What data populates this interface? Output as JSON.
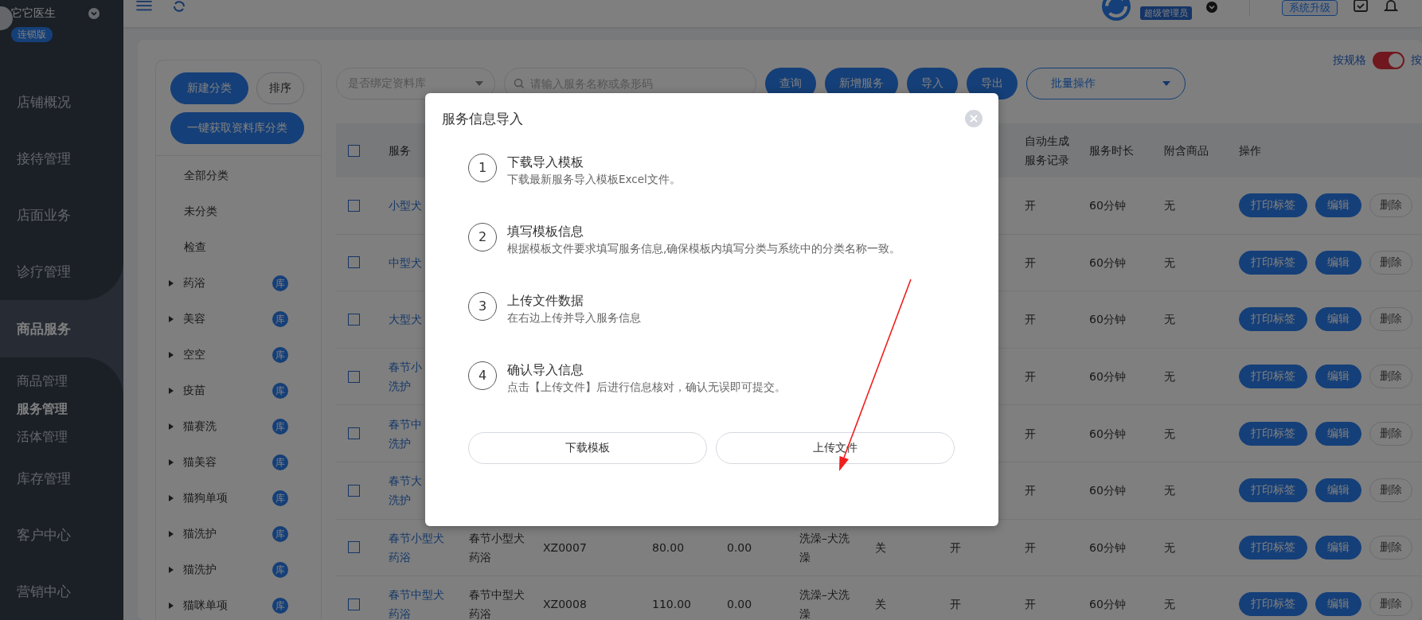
{
  "app": {
    "name": "它它医生",
    "edition": "连锁版"
  },
  "topbar": {
    "role_badge": "超级管理员",
    "upgrade_button": "系统升级"
  },
  "sidebar": {
    "items": [
      {
        "label": "店铺概况",
        "selected": false
      },
      {
        "label": "接待管理",
        "selected": false
      },
      {
        "label": "店面业务",
        "selected": false
      },
      {
        "label": "诊疗管理",
        "selected": false
      },
      {
        "label": "商品服务",
        "selected": true,
        "children": [
          {
            "label": "商品管理",
            "selected": false
          },
          {
            "label": "服务管理",
            "selected": true
          },
          {
            "label": "活体管理",
            "selected": false
          }
        ]
      },
      {
        "label": "库存管理",
        "selected": false
      },
      {
        "label": "客户中心",
        "selected": false
      },
      {
        "label": "营销中心",
        "selected": false
      }
    ]
  },
  "categories": {
    "buttons": [
      {
        "label": "新建分类",
        "kind": "primary"
      },
      {
        "label": "排序",
        "kind": "outline"
      },
      {
        "label": "一键获取资料库分类",
        "kind": "primary"
      }
    ],
    "items": [
      {
        "label": "全部分类",
        "expandable": false
      },
      {
        "label": "未分类",
        "expandable": false
      },
      {
        "label": "检查",
        "expandable": false
      },
      {
        "label": "药浴",
        "expandable": true,
        "badge": "库"
      },
      {
        "label": "美容",
        "expandable": true,
        "badge": "库"
      },
      {
        "label": "空空",
        "expandable": true,
        "badge": "库"
      },
      {
        "label": "疫苗",
        "expandable": true,
        "badge": "库"
      },
      {
        "label": "猫赛洗",
        "expandable": true,
        "badge": "库"
      },
      {
        "label": "猫美容",
        "expandable": true,
        "badge": "库"
      },
      {
        "label": "猫狗单项",
        "expandable": true,
        "badge": "库"
      },
      {
        "label": "猫洗护",
        "expandable": true,
        "badge": "库"
      },
      {
        "label": "猫洗护",
        "expandable": true,
        "badge": "库"
      },
      {
        "label": "猫咪单项",
        "expandable": true,
        "badge": "库"
      }
    ]
  },
  "toolbar": {
    "bind_filter": {
      "placeholder": "是否绑定资料库"
    },
    "search": {
      "placeholder": "请输入服务名称或条形码"
    },
    "buttons": [
      "查询",
      "新增服务",
      "导入",
      "导出"
    ],
    "batch": {
      "label": "批量操作"
    },
    "spec_toggle": {
      "label": "按规格",
      "on": true,
      "after": "按"
    }
  },
  "table": {
    "header": {
      "checked": false,
      "service": "服务",
      "auto_record": "自动生成服务记录",
      "duration": "服务时长",
      "goods": "附含商品",
      "actions": "操作"
    },
    "rows": [
      {
        "checked": false,
        "name_lines": [
          "小型犬"
        ],
        "auto_record": "开",
        "duration": "60分钟",
        "goods": "无",
        "actions": [
          {
            "label": "打印标签",
            "kind": "primary"
          },
          {
            "label": "编辑",
            "kind": "primary"
          },
          {
            "label": "删除",
            "kind": "outline"
          }
        ]
      },
      {
        "checked": false,
        "name_lines": [
          "中型犬"
        ],
        "auto_record": "开",
        "duration": "60分钟",
        "goods": "无",
        "actions": [
          {
            "label": "打印标签",
            "kind": "primary"
          },
          {
            "label": "编辑",
            "kind": "primary"
          },
          {
            "label": "删除",
            "kind": "outline"
          }
        ]
      },
      {
        "checked": false,
        "name_lines": [
          "大型犬"
        ],
        "auto_record": "开",
        "duration": "60分钟",
        "goods": "无",
        "actions": [
          {
            "label": "打印标签",
            "kind": "primary"
          },
          {
            "label": "编辑",
            "kind": "primary"
          },
          {
            "label": "删除",
            "kind": "outline"
          }
        ]
      },
      {
        "checked": false,
        "name_lines": [
          "春节小",
          "洗护"
        ],
        "auto_record": "开",
        "duration": "60分钟",
        "goods": "无",
        "actions": [
          {
            "label": "打印标签",
            "kind": "primary"
          },
          {
            "label": "编辑",
            "kind": "primary"
          },
          {
            "label": "删除",
            "kind": "outline"
          }
        ]
      },
      {
        "checked": false,
        "name_lines": [
          "春节中",
          "洗护"
        ],
        "auto_record": "开",
        "duration": "60分钟",
        "goods": "无",
        "actions": [
          {
            "label": "打印标签",
            "kind": "primary"
          },
          {
            "label": "编辑",
            "kind": "primary"
          },
          {
            "label": "删除",
            "kind": "outline"
          }
        ]
      },
      {
        "checked": false,
        "name_lines": [
          "春节大",
          "洗护"
        ],
        "auto_record": "开",
        "duration": "60分钟",
        "goods": "无",
        "actions": [
          {
            "label": "打印标签",
            "kind": "primary"
          },
          {
            "label": "编辑",
            "kind": "primary"
          },
          {
            "label": "删除",
            "kind": "outline"
          }
        ]
      },
      {
        "checked": false,
        "name_lines": [
          "春节小型犬",
          "药浴"
        ],
        "alias": "春节小型犬药浴",
        "code": "XZ0007",
        "price": "80.00",
        "cost": "0.00",
        "category": "洗澡–犬洗澡",
        "column_7": "关",
        "column_8": "开",
        "auto_record": "开",
        "duration": "60分钟",
        "goods": "无",
        "actions": [
          {
            "label": "打印标签",
            "kind": "primary"
          },
          {
            "label": "编辑",
            "kind": "primary"
          },
          {
            "label": "删除",
            "kind": "outline"
          }
        ]
      },
      {
        "checked": false,
        "name_lines": [
          "春节中型犬",
          "药浴"
        ],
        "alias": "春节中型犬药浴",
        "code": "XZ0008",
        "price": "110.00",
        "cost": "0.00",
        "category": "洗澡–犬洗澡",
        "column_7": "关",
        "column_8": "开",
        "auto_record": "开",
        "duration": "60分钟",
        "goods": "无",
        "actions": [
          {
            "label": "打印标签",
            "kind": "primary"
          },
          {
            "label": "编辑",
            "kind": "primary"
          },
          {
            "label": "删除",
            "kind": "outline"
          }
        ]
      }
    ]
  },
  "modal": {
    "title": "服务信息导入",
    "steps": [
      {
        "number": "1",
        "title": "下载导入模板",
        "description": "下载最新服务导入模板Excel文件。"
      },
      {
        "number": "2",
        "title": "填写模板信息",
        "description": "根据模板文件要求填写服务信息,确保模板内填写分类与系统中的分类名称一致。"
      },
      {
        "number": "3",
        "title": "上传文件数据",
        "description": "在右边上传并导入服务信息"
      },
      {
        "number": "4",
        "title": "确认导入信息",
        "description": "点击【上传文件】后进行信息核对，确认无误即可提交。"
      }
    ],
    "buttons": [
      "下载模板",
      "上传文件"
    ]
  }
}
